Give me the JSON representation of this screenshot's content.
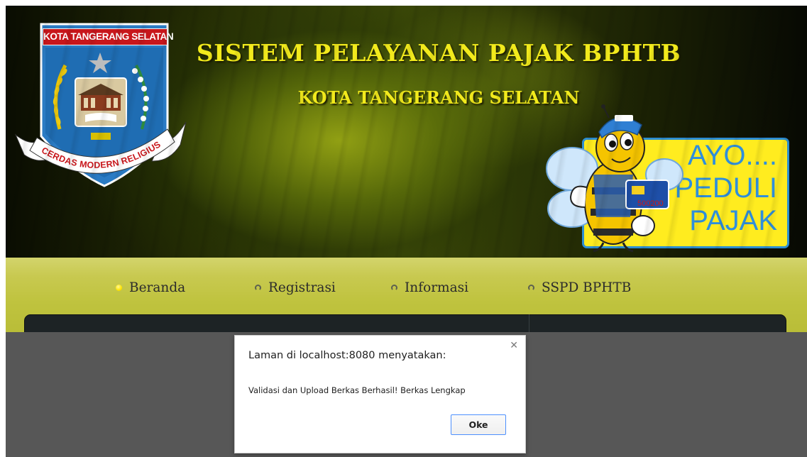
{
  "header": {
    "title": "SISTEM PELAYANAN PAJAK BPHTB",
    "subtitle": "KOTA TANGERANG SELATAN",
    "emblem": {
      "banner_text": "KOTA TANGERANG SELATAN",
      "motto": "CERDAS MODERN RELIGIUS"
    },
    "poster": {
      "lines": [
        "AYO....",
        "PEDULI",
        "PAJAK"
      ],
      "card_number": "500200"
    }
  },
  "nav": {
    "items": [
      {
        "label": "Beranda",
        "active": true
      },
      {
        "label": "Registrasi",
        "active": false
      },
      {
        "label": "Informasi",
        "active": false
      },
      {
        "label": "SSPD BPHTB",
        "active": false
      }
    ]
  },
  "dialog": {
    "title": "Laman di localhost:8080 menyatakan:",
    "message": "Validasi dan Upload Berkas Berhasil! Berkas Lengkap",
    "ok_label": "Oke",
    "close_icon": "close-icon"
  },
  "colors": {
    "title_yellow": "#f2ea1c",
    "nav_bar": "#c8c950",
    "overlay": "#575757",
    "poster_yellow": "#ffec1f",
    "poster_blue": "#2f8fdc",
    "emblem_red": "#c8161b",
    "focus_blue": "#4d90fe"
  }
}
